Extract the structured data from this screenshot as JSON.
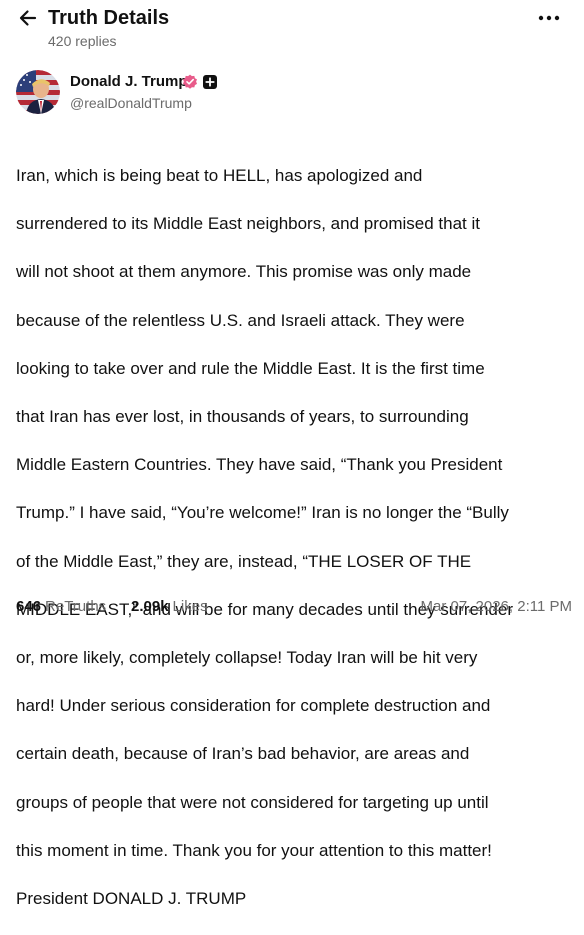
{
  "header": {
    "title": "Truth Details",
    "replies": "420 replies",
    "back_icon": "arrow-left-icon",
    "more_icon": "more-horizontal-icon"
  },
  "author": {
    "name": "Donald J. Trump",
    "handle": "@realDonaldTrump",
    "verified_icon": "verified-badge-icon",
    "verified_color": "#e85b8a",
    "plus_icon": "plus-square-icon"
  },
  "post": {
    "lines": [
      "Iran, which is being beat to HELL, has apologized and",
      "surrendered to its Middle East neighbors, and promised that it",
      "will not shoot at them anymore. This promise was only made",
      "because of the relentless U.S. and Israeli attack. They were",
      "looking to take over and rule the Middle East. It is the first time",
      "that Iran has ever lost, in thousands of years, to surrounding",
      "Middle Eastern Countries. They have said, “Thank you President",
      "Trump.” I have said, “You’re welcome!” Iran is no longer the “Bully",
      "of the Middle East,” they are, instead, “THE LOSER OF THE",
      "MIDDLE EAST,” and will be for many decades until they surrender",
      "or, more likely, completely collapse! Today Iran will be hit very",
      "hard! Under serious consideration for complete destruction and",
      "certain death, because of Iran’s bad behavior, are areas and",
      "groups of people that were not considered for targeting up until",
      "this moment in time. Thank you for your attention to this matter!",
      "President DONALD J. TRUMP"
    ]
  },
  "stats": {
    "retruths_count": "646",
    "retruths_label": "ReTruths",
    "likes_count": "2.09k",
    "likes_label": "Likes",
    "timestamp": "Mar 07, 2026, 2:11 PM"
  }
}
